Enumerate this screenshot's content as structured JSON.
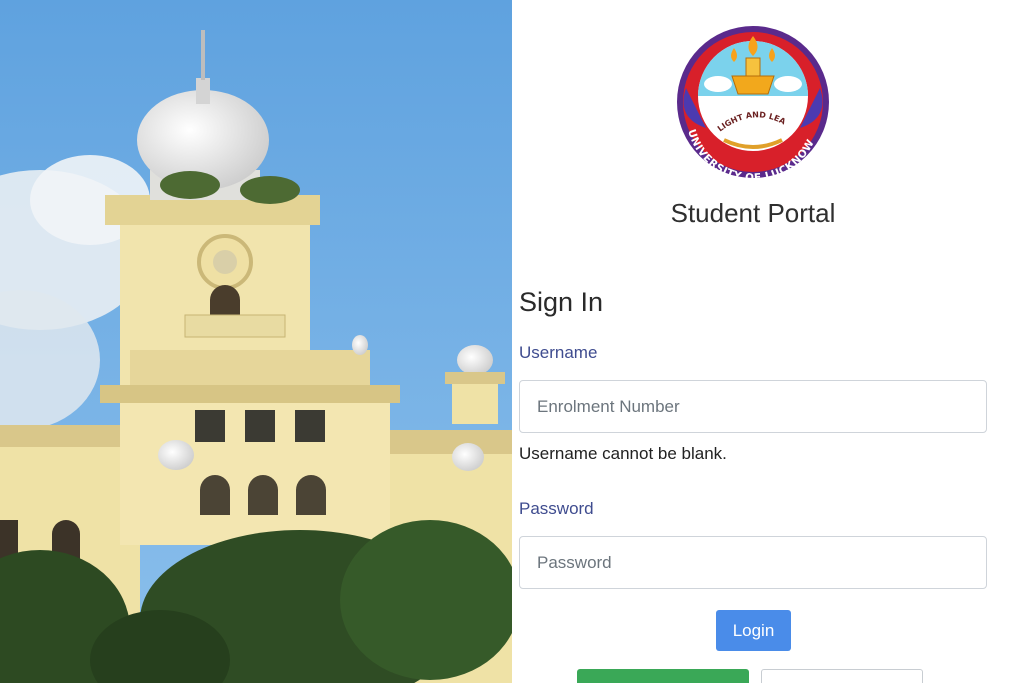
{
  "portal": {
    "title": "Student Portal",
    "logo": {
      "motto": "LIGHT AND LEARNING",
      "name": "UNIVERSITY OF LUCKNOW"
    }
  },
  "form": {
    "heading": "Sign In",
    "username_label": "Username",
    "username_placeholder": "Enrolment Number",
    "username_error": "Username cannot be blank.",
    "password_label": "Password",
    "password_placeholder": "Password",
    "login_label": "Login"
  },
  "colors": {
    "label": "#3f4c8f",
    "login_button": "#4a8ce9",
    "green_button": "#3aa857"
  }
}
